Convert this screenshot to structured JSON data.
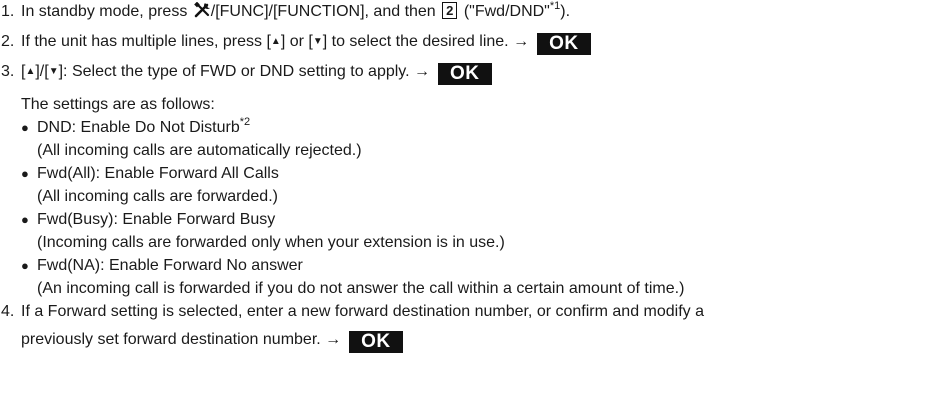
{
  "step1": {
    "num": "1.",
    "a": "In standby mode, press ",
    "b": "/[FUNC]/[FUNCTION], and then ",
    "key": "2",
    "c": " (\"Fwd/DND\"",
    "sup": "*1",
    "d": ")."
  },
  "step2": {
    "num": "2.",
    "a": "If the unit has multiple lines, press [",
    "up": "▲",
    "b": "] or [",
    "down": "▼",
    "c": "] to select the desired line. →",
    "ok": "OK"
  },
  "step3": {
    "num": "3.",
    "a": "[",
    "up": "▲",
    "b": "]/[",
    "down": "▼",
    "c": "]: Select the type of FWD or DND setting to apply. →",
    "ok": "OK",
    "intro": "The settings are as follows:",
    "options": [
      {
        "label": "DND: Enable Do Not Disturb",
        "sup": "*2",
        "desc": "(All incoming calls are automatically rejected.)"
      },
      {
        "label": "Fwd(All): Enable Forward All Calls",
        "desc": "(All incoming calls are forwarded.)"
      },
      {
        "label": "Fwd(Busy): Enable Forward Busy",
        "desc": "(Incoming calls are forwarded only when your extension is in use.)"
      },
      {
        "label": "Fwd(NA): Enable Forward No answer",
        "desc": "(An incoming call is forwarded if you do not answer the call within a certain amount of time.)"
      }
    ]
  },
  "step4": {
    "num": "4.",
    "line1": "If a Forward setting is selected, enter a new forward destination number, or confirm and modify a",
    "line2": "previously set forward destination number. →",
    "ok": "OK"
  },
  "icons": {
    "function_key": "wrench-screwdriver-icon",
    "bullet": "bullet-dot-icon"
  }
}
